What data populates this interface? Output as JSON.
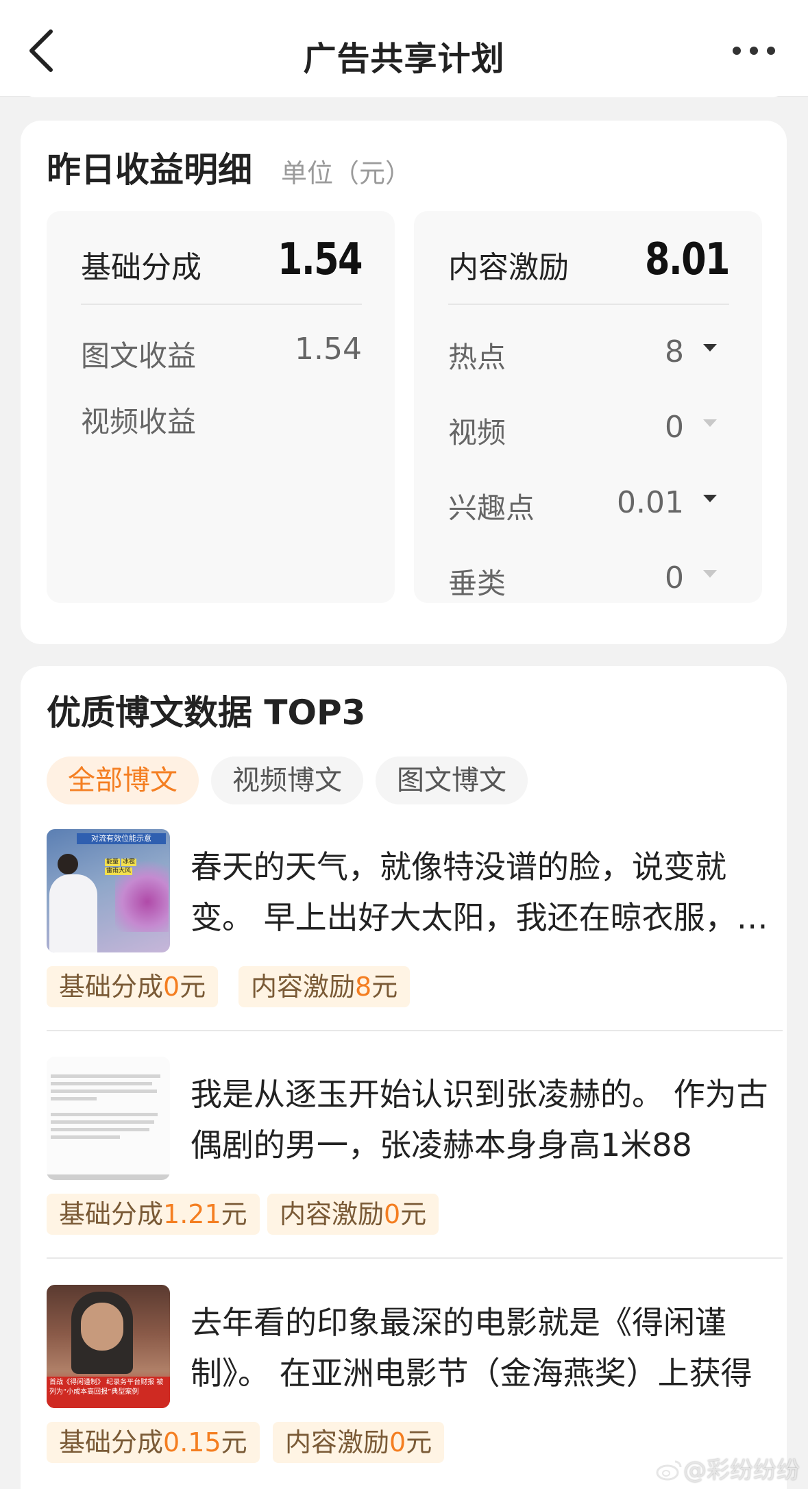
{
  "nav": {
    "title": "广告共享计划"
  },
  "earnings": {
    "title": "昨日收益明细",
    "unit": "单位（元）",
    "base": {
      "label": "基础分成",
      "value": "1.54",
      "rows": [
        {
          "label": "图文收益",
          "value": "1.54"
        },
        {
          "label": "视频收益",
          "value": ""
        }
      ]
    },
    "incentive": {
      "label": "内容激励",
      "value": "8.01",
      "rows": [
        {
          "label": "热点",
          "value": "8"
        },
        {
          "label": "视频",
          "value": "0"
        },
        {
          "label": "兴趣点",
          "value": "0.01"
        },
        {
          "label": "垂类",
          "value": "0"
        }
      ]
    }
  },
  "top_posts": {
    "title": "优质博文数据 TOP3",
    "tabs": [
      "全部博文",
      "视频博文",
      "图文博文"
    ],
    "active_tab": "全部博文",
    "posts": [
      {
        "text": "春天的天气，就像特没谱的脸，说变就变。 早上出好大太阳，我还在晾衣服，下午就下起了雨",
        "base_label": "基础分成",
        "base_amount": "0",
        "base_unit": "元",
        "incentive_label": "内容激励",
        "incentive_amount": "8",
        "incentive_unit": "元",
        "thumb_caption": "对流有效位能示意",
        "thumb_chips": [
          "能量",
          "冰雹",
          "雷雨大风"
        ]
      },
      {
        "text": "我是从逐玉开始认识到张凌赫的。 作为古偶剧的男一，张凌赫本身身高1米88",
        "base_label": "基础分成",
        "base_amount": "1.21",
        "base_unit": "元",
        "incentive_label": "内容激励",
        "incentive_amount": "0",
        "incentive_unit": "元"
      },
      {
        "text": "去年看的印象最深的电影就是《得闲谨制》。 在亚洲电影节（金海燕奖）上获得",
        "base_label": "基础分成",
        "base_amount": "0.15",
        "base_unit": "元",
        "incentive_label": "内容激励",
        "incentive_amount": "0",
        "incentive_unit": "元",
        "thumb_caption": "首战《得闲谨制》 纪录务平台财报 被列为“小成本高回报”典型案例"
      }
    ]
  },
  "watermark": "@彩纷纷纷",
  "colors": {
    "accent": "#f47e21",
    "tag_bg": "#fff4e4",
    "page_bg": "#f2f2f2"
  }
}
